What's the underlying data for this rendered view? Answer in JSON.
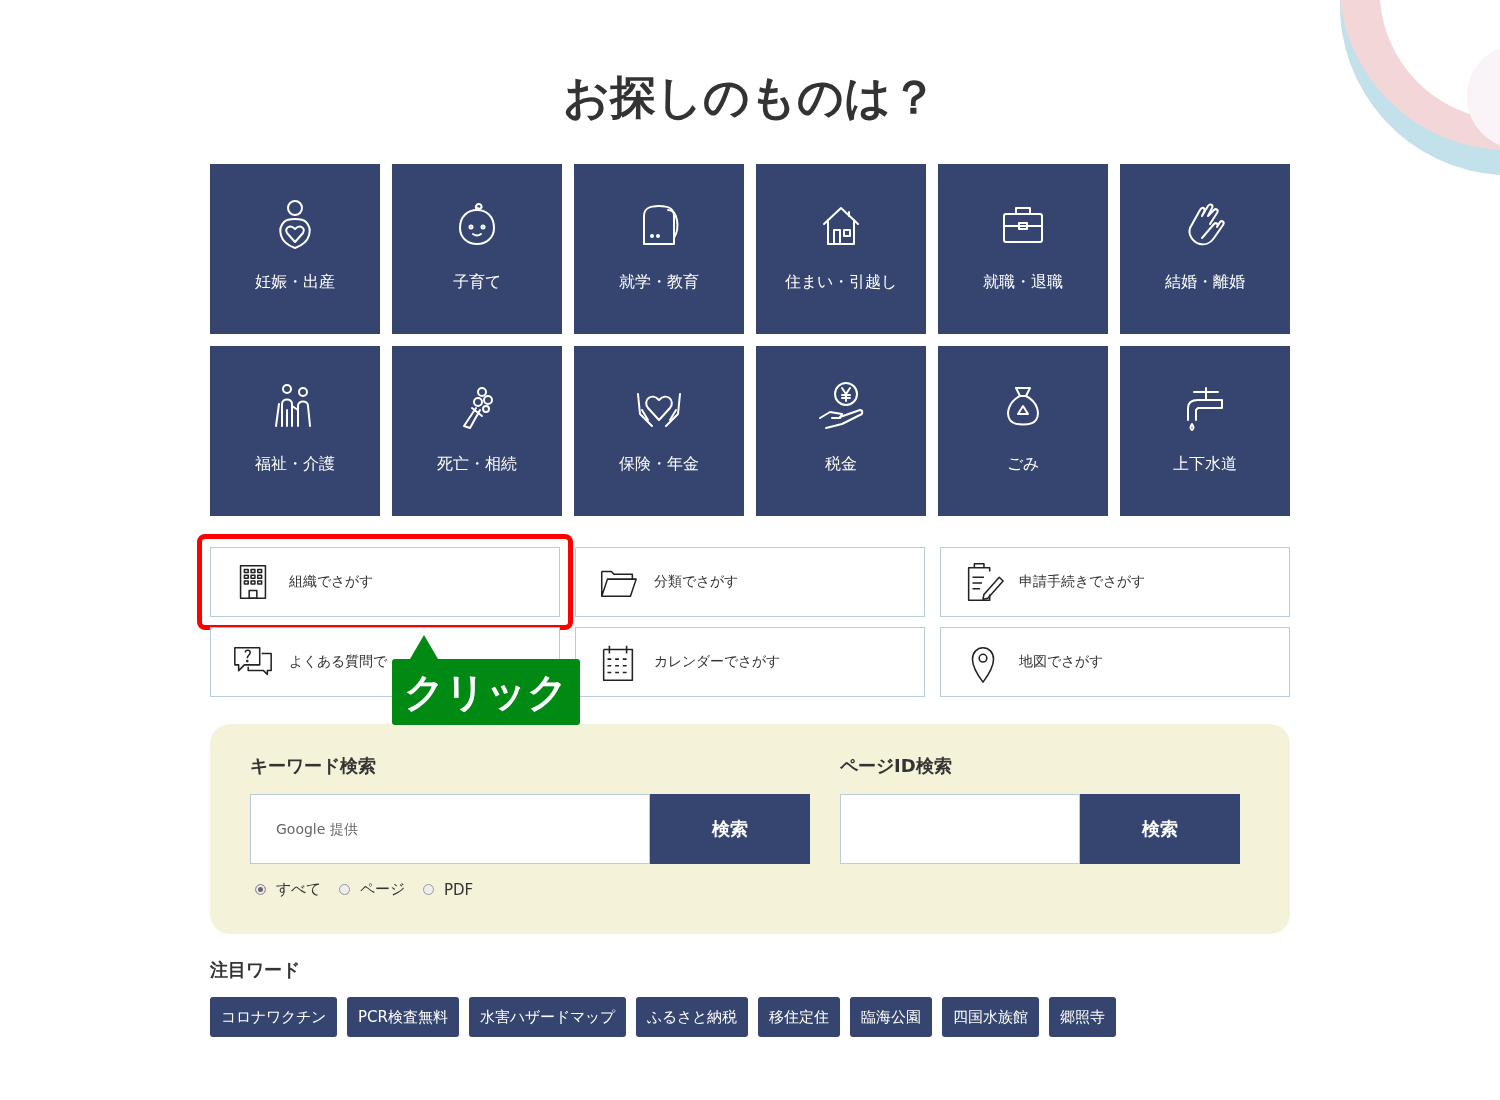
{
  "heading": "お探しのものは？",
  "categories": [
    {
      "label": "妊娠・出産"
    },
    {
      "label": "子育て"
    },
    {
      "label": "就学・教育"
    },
    {
      "label": "住まい・引越し"
    },
    {
      "label": "就職・退職"
    },
    {
      "label": "結婚・離婚"
    },
    {
      "label": "福祉・介護"
    },
    {
      "label": "死亡・相続"
    },
    {
      "label": "保険・年金"
    },
    {
      "label": "税金"
    },
    {
      "label": "ごみ"
    },
    {
      "label": "上下水道"
    }
  ],
  "links": [
    {
      "label": "組織でさがす",
      "highlighted": true
    },
    {
      "label": "分類でさがす",
      "highlighted": false
    },
    {
      "label": "申請手続きでさがす",
      "highlighted": false
    },
    {
      "label": "よくある質問で",
      "highlighted": false
    },
    {
      "label": "カレンダーでさがす",
      "highlighted": false
    },
    {
      "label": "地図でさがす",
      "highlighted": false
    }
  ],
  "callout": {
    "text": "クリック"
  },
  "keyword_search": {
    "title": "キーワード検索",
    "placeholder": "Google 提供",
    "button": "検索",
    "scopes": [
      {
        "label": "すべて",
        "selected": true
      },
      {
        "label": "ページ",
        "selected": false
      },
      {
        "label": "PDF",
        "selected": false
      }
    ]
  },
  "page_id_search": {
    "title": "ページID検索",
    "button": "検索"
  },
  "featured_words": {
    "title": "注目ワード",
    "tags": [
      "コロナワクチン",
      "PCR検査無料",
      "水害ハザードマップ",
      "ふるさと納税",
      "移住定住",
      "臨海公園",
      "四国水族館",
      "郷照寺"
    ]
  }
}
